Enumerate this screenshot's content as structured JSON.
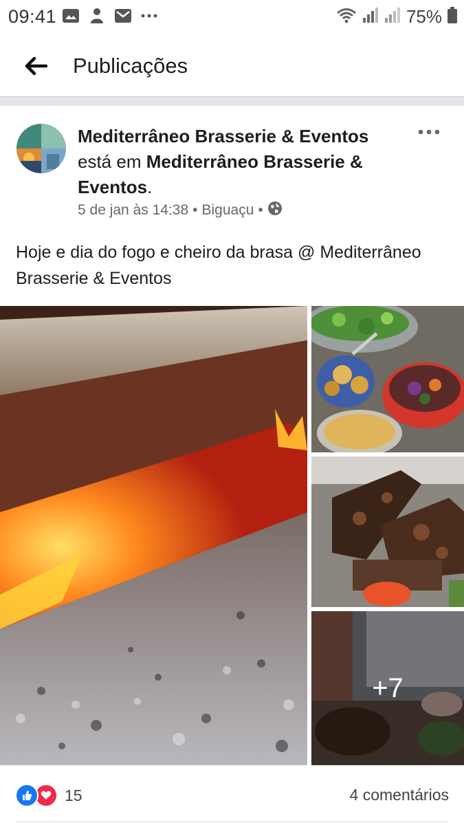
{
  "status_bar": {
    "time": "09:41",
    "battery": "75%"
  },
  "header": {
    "title": "Publicações"
  },
  "post": {
    "author": "Mediterrâneo Brasserie & Eventos",
    "location_prefix": "está em",
    "location": "Mediterrâneo Brasserie & Eventos",
    "location_suffix": ".",
    "date": "5 de jan às 14:38",
    "place": "Biguaçu",
    "separator": "•",
    "text": "Hoje e dia do fogo e cheiro da brasa  @ Mediterrâneo Brasserie & Eventos",
    "photos": {
      "more_count": "+7"
    }
  },
  "reactions": {
    "count": "15",
    "comments": "4 comentários"
  },
  "colors": {
    "accent": "#1877f2",
    "love": "#f02849",
    "meta_text": "#65676b"
  }
}
